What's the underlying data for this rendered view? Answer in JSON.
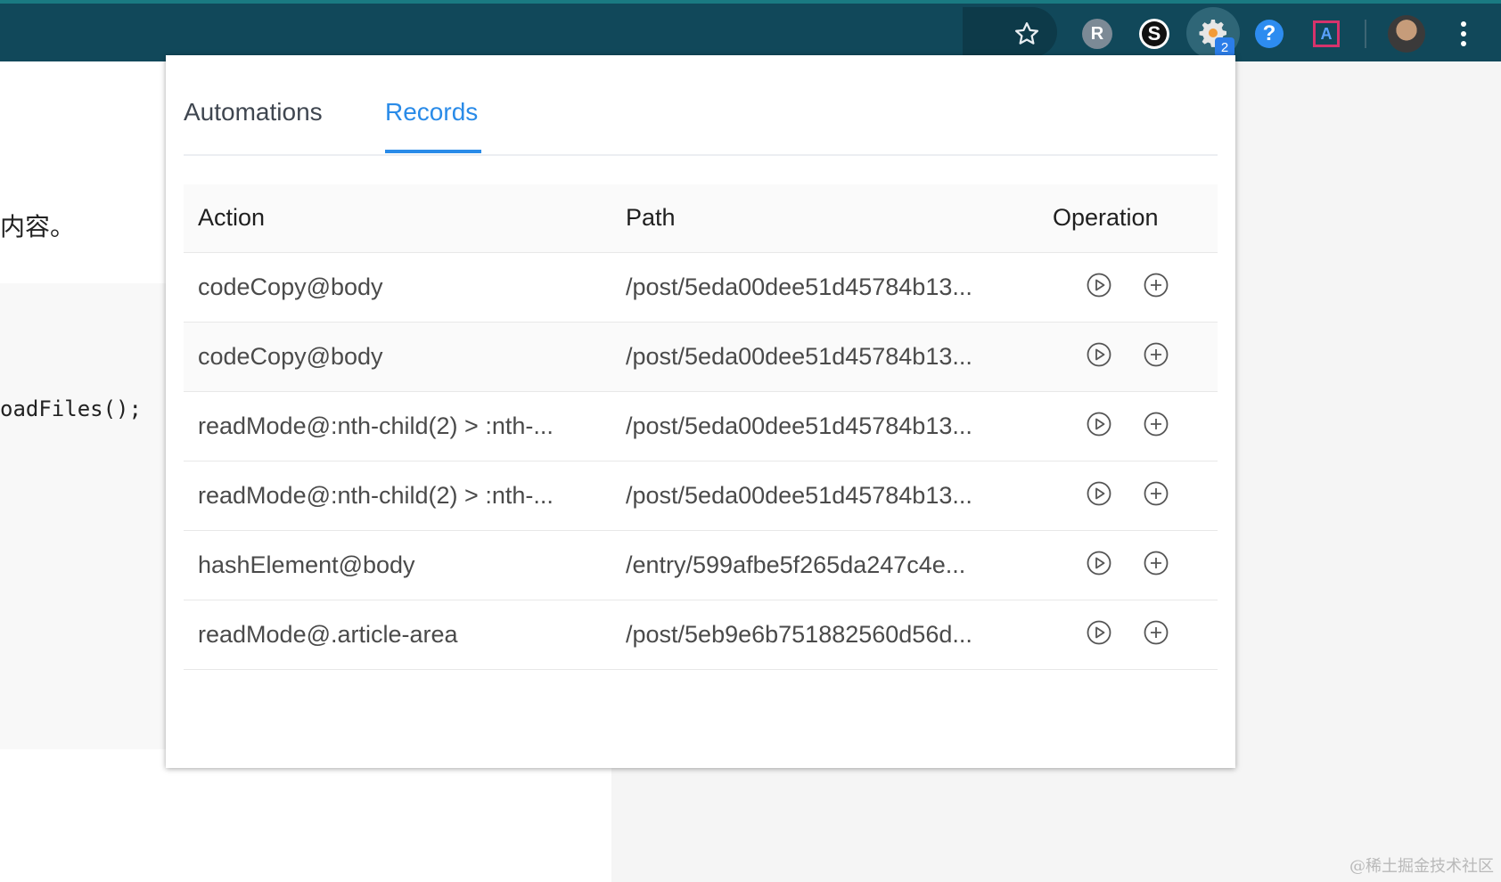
{
  "page": {
    "text_fragment": "内容。",
    "code_fragment": "oadFiles();",
    "watermark": "@稀土掘金技术社区"
  },
  "toolbar": {
    "icons": [
      "star-icon",
      "r-avatar",
      "s-extension-icon",
      "gear-extension-icon",
      "help-extension-icon",
      "a-extension-icon",
      "profile-avatar",
      "menu-icon"
    ],
    "r_avatar_letter": "R",
    "s_ext_letter": "S",
    "help_glyph": "?",
    "a_ext_letter": "A",
    "badge_count": "2"
  },
  "popup": {
    "tabs": [
      {
        "label": "Automations",
        "active": false
      },
      {
        "label": "Records",
        "active": true
      }
    ],
    "accent_color": "#2a8be8",
    "table": {
      "headers": {
        "action": "Action",
        "path": "Path",
        "operation": "Operation"
      },
      "rows": [
        {
          "action": "codeCopy@body",
          "path": "/post/5eda00dee51d45784b13..."
        },
        {
          "action": "codeCopy@body",
          "path": "/post/5eda00dee51d45784b13..."
        },
        {
          "action": "readMode@:nth-child(2) > :nth-...",
          "path": "/post/5eda00dee51d45784b13..."
        },
        {
          "action": "readMode@:nth-child(2) > :nth-...",
          "path": "/post/5eda00dee51d45784b13..."
        },
        {
          "action": "hashElement@body",
          "path": "/entry/599afbe5f265da247c4e..."
        },
        {
          "action": "readMode@.article-area",
          "path": "/post/5eb9e6b751882560d56d..."
        }
      ]
    }
  }
}
